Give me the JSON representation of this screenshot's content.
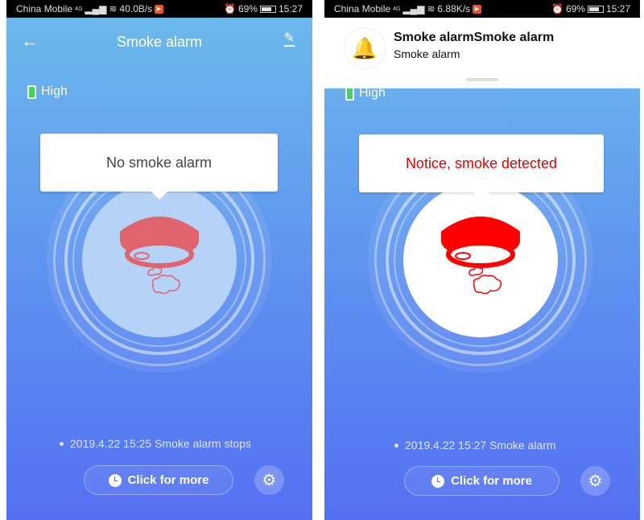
{
  "colors": {
    "normal_icon": "#e0646e",
    "alarm_icon": "#ff0000",
    "alarm_text": "#e00000",
    "bell": "#f7b500"
  },
  "left": {
    "status": {
      "carrier": "China Mobile",
      "network": "4G",
      "speed": "40.0B/s",
      "battery": "69%",
      "time": "15:27"
    },
    "title": "Smoke alarm",
    "battery_level": "High",
    "status_message": "No smoke alarm",
    "log": "2019.4.22 15:25 Smoke alarm stops",
    "more_button": "Click for more"
  },
  "right": {
    "status": {
      "carrier": "China Mobile",
      "network": "4G",
      "speed": "6.88K/s",
      "battery": "69%",
      "time": "15:27"
    },
    "notification": {
      "title": "Smoke alarmSmoke alarm",
      "body": "Smoke alarm",
      "icon": "bell-icon"
    },
    "battery_level": "High",
    "status_message": "Notice, smoke detected",
    "log": "2019.4.22 15:27 Smoke alarm",
    "more_button": "Click for more"
  }
}
